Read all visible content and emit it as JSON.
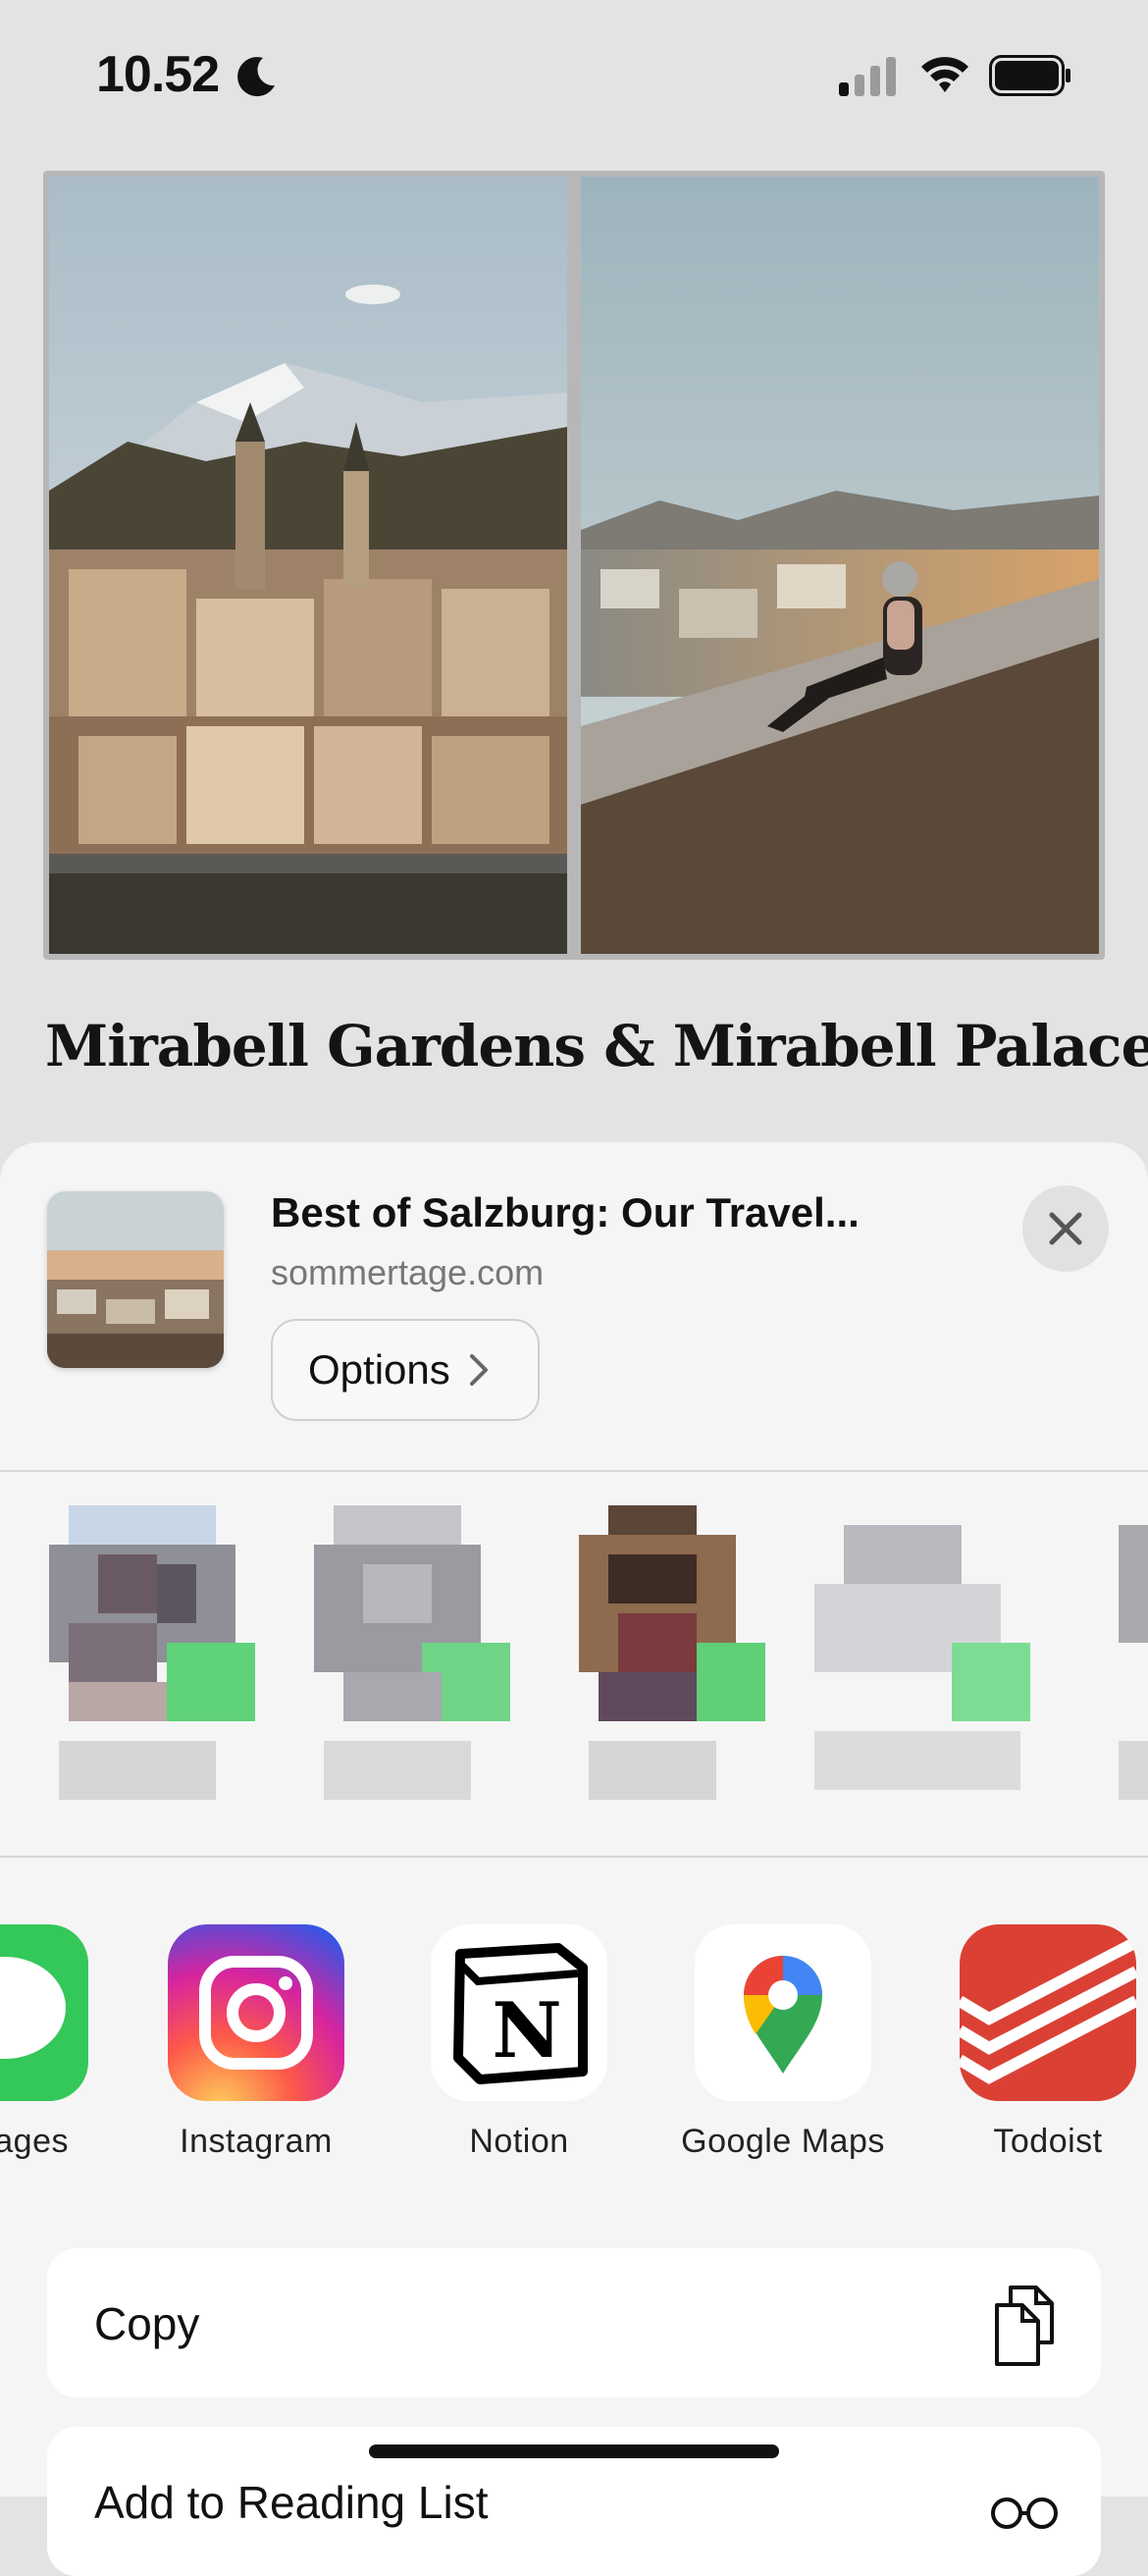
{
  "status_bar": {
    "time": "10.52",
    "icons": [
      "moon-icon",
      "cellular-signal-icon",
      "wifi-icon",
      "battery-icon"
    ]
  },
  "article": {
    "title": "Mirabell Gardens & Mirabell Palace"
  },
  "share_sheet": {
    "preview": {
      "title": "Best of Salzburg: Our Travel...",
      "url": "sommertage.com",
      "options_label": "Options"
    },
    "apps": [
      {
        "label": "ages",
        "icon": "messages-icon",
        "color": "#34c759"
      },
      {
        "label": "Instagram",
        "icon": "instagram-icon",
        "color": "#e1306c"
      },
      {
        "label": "Notion",
        "icon": "notion-icon",
        "color": "#000000"
      },
      {
        "label": "Google Maps",
        "icon": "google-maps-icon",
        "color": "#4285f4"
      },
      {
        "label": "Todoist",
        "icon": "todoist-icon",
        "color": "#db4035"
      }
    ],
    "actions": [
      {
        "label": "Copy",
        "icon": "copy-icon"
      },
      {
        "label": "Add to Reading List",
        "icon": "glasses-icon"
      }
    ]
  }
}
